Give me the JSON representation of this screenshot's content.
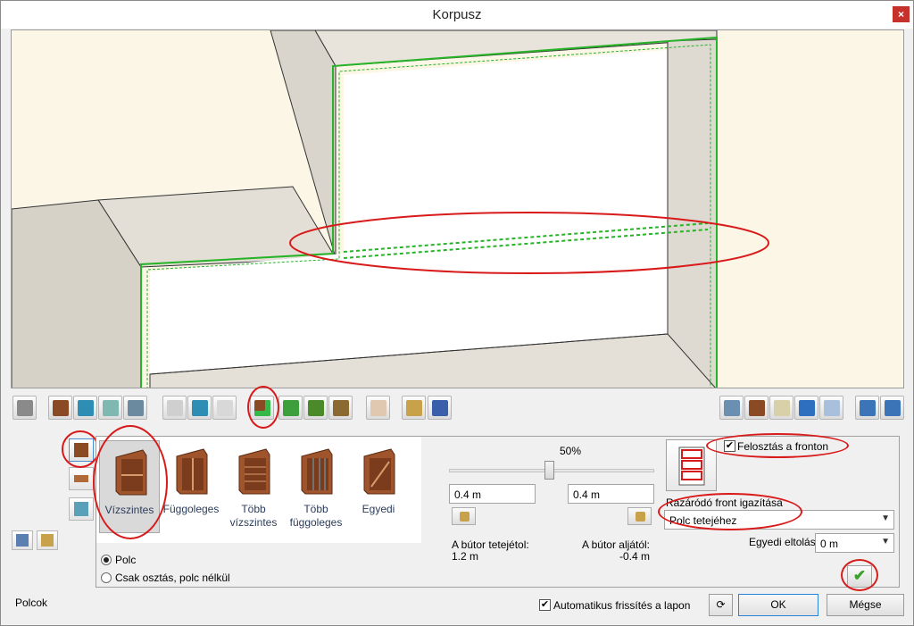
{
  "window": {
    "title": "Korpusz",
    "close": "×"
  },
  "shelf_types": [
    {
      "label": "Vízszintes",
      "selected": true
    },
    {
      "label": "Függoleges",
      "selected": false
    },
    {
      "label": "Több vízszintes",
      "selected": false
    },
    {
      "label": "Több függoleges",
      "selected": false
    },
    {
      "label": "Egyedi",
      "selected": false
    }
  ],
  "options": {
    "shelf": "Polc",
    "divide_only": "Csak osztás, polc nélkül",
    "selected": "shelf"
  },
  "slider": {
    "percent_label": "50%",
    "value": 0.5
  },
  "inputs": {
    "left_value": "0.4 m",
    "right_value": "0.4 m"
  },
  "distances": {
    "from_top_label": "A bútor tetejétol:",
    "from_top_value": "1.2 m",
    "from_bottom_label": "A bútor aljától:",
    "from_bottom_value": "-0.4 m"
  },
  "front": {
    "split_on_front_label": "Felosztás a fronton",
    "split_on_front_checked": true,
    "alignment_label": "Razáródó front igazítása",
    "alignment_value": "Polc tetejéhez",
    "offset_label": "Egyedi eltolás",
    "offset_value": "0 m"
  },
  "footer": {
    "status": "Polcok",
    "auto_refresh_label": "Automatikus frissítés a lapon",
    "auto_refresh_checked": true,
    "ok": "OK",
    "cancel": "Mégse"
  },
  "icons": {
    "close": "close-icon",
    "apply": "checkmark-icon",
    "refresh": "refresh-icon"
  },
  "colors": {
    "selection_green": "#27b327",
    "annotation_red": "#d91a1a",
    "wood": "#a0542b"
  }
}
